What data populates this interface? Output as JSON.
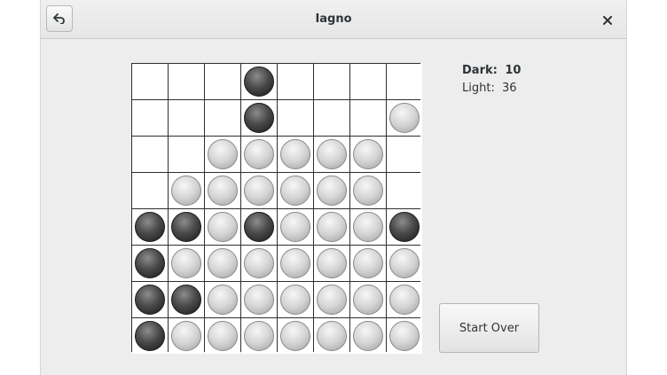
{
  "window": {
    "title": "Iagno"
  },
  "icons": {
    "back": "back-arrow-icon",
    "close": "close-icon"
  },
  "score": {
    "dark_label": "Dark:",
    "dark_value": "10",
    "light_label": "Light:",
    "light_value": "36"
  },
  "board": {
    "size": 8,
    "rows": [
      [
        "",
        "",
        "",
        "D",
        "",
        "",
        "",
        ""
      ],
      [
        "",
        "",
        "",
        "D",
        "",
        "",
        "",
        "L"
      ],
      [
        "",
        "",
        "L",
        "L",
        "L",
        "L",
        "L",
        ""
      ],
      [
        "",
        "L",
        "L",
        "L",
        "L",
        "L",
        "L",
        ""
      ],
      [
        "D",
        "D",
        "L",
        "D",
        "L",
        "L",
        "L",
        "D"
      ],
      [
        "D",
        "L",
        "L",
        "L",
        "L",
        "L",
        "L",
        "L"
      ],
      [
        "D",
        "D",
        "L",
        "L",
        "L",
        "L",
        "L",
        "L"
      ],
      [
        "D",
        "L",
        "L",
        "L",
        "L",
        "L",
        "L",
        "L"
      ]
    ]
  },
  "actions": {
    "start_over_label": "Start Over"
  },
  "colors": {
    "dark_piece": "#3a3a3a",
    "light_piece": "#d4d4d4",
    "grid": "#2e2e2e"
  }
}
